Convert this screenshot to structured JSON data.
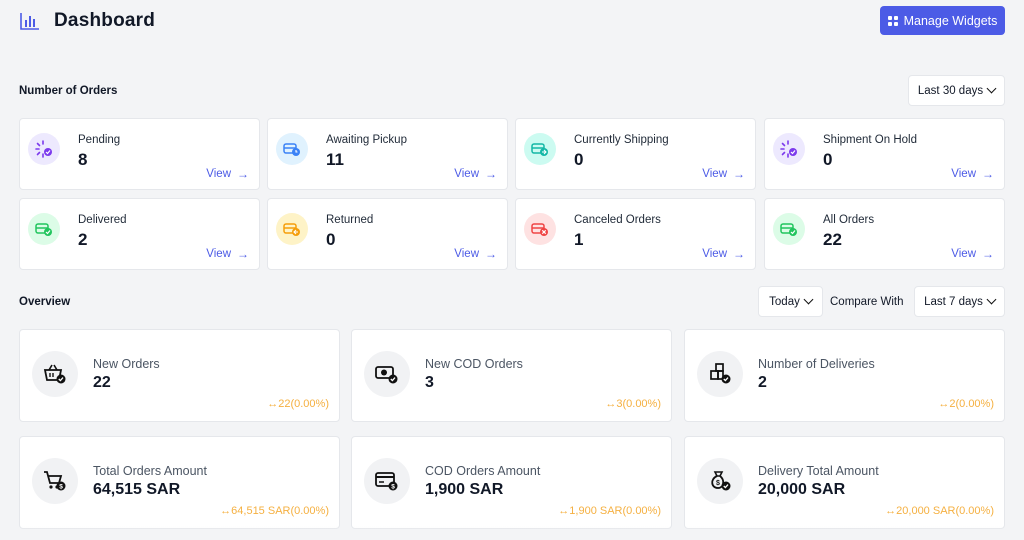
{
  "header": {
    "title": "Dashboard",
    "manage_label": "Manage Widgets",
    "logo_icon": "bar-chart-icon"
  },
  "orders_section": {
    "title": "Number of Orders",
    "range": "Last 30 days",
    "view_label": "View",
    "cards": [
      {
        "label": "Pending",
        "count": "8",
        "icon": "pending-icon",
        "color": "#7c3aed",
        "bg": "#ede9fe"
      },
      {
        "label": "Awaiting Pickup",
        "count": "11",
        "icon": "truck-clock-icon",
        "color": "#3b82f6",
        "bg": "#e0f2fe"
      },
      {
        "label": "Currently Shipping",
        "count": "0",
        "icon": "truck-shipping-icon",
        "color": "#14b8a6",
        "bg": "#ccfbf1"
      },
      {
        "label": "Shipment On Hold",
        "count": "0",
        "icon": "pending-icon",
        "color": "#7c3aed",
        "bg": "#ede9fe"
      },
      {
        "label": "Delivered",
        "count": "2",
        "icon": "truck-check-icon",
        "color": "#22c55e",
        "bg": "#dcfce7"
      },
      {
        "label": "Returned",
        "count": "0",
        "icon": "truck-return-icon",
        "color": "#f59e0b",
        "bg": "#fef3c7"
      },
      {
        "label": "Canceled Orders",
        "count": "1",
        "icon": "truck-cancel-icon",
        "color": "#ef4444",
        "bg": "#fee2e2"
      },
      {
        "label": "All Orders",
        "count": "22",
        "icon": "truck-check-icon",
        "color": "#22c55e",
        "bg": "#dcfce7"
      }
    ]
  },
  "overview": {
    "title": "Overview",
    "period": "Today",
    "compare_label": "Compare With",
    "compare_range": "Last 7 days",
    "cards": [
      {
        "label": "New Orders",
        "value": "22",
        "compare": "↔22(0.00%)",
        "icon": "basket-check-icon"
      },
      {
        "label": "New COD Orders",
        "value": "3",
        "compare": "↔3(0.00%)",
        "icon": "cash-check-icon"
      },
      {
        "label": "Number of Deliveries",
        "value": "2",
        "compare": "↔2(0.00%)",
        "icon": "boxes-check-icon"
      },
      {
        "label": "Total Orders Amount",
        "value": "64,515 SAR",
        "compare": "↔64,515 SAR(0.00%)",
        "icon": "cart-dollar-icon"
      },
      {
        "label": "COD Orders Amount",
        "value": "1,900 SAR",
        "compare": "↔1,900 SAR(0.00%)",
        "icon": "card-dollar-icon"
      },
      {
        "label": "Delivery Total Amount",
        "value": "20,000 SAR",
        "compare": "↔20,000 SAR(0.00%)",
        "icon": "moneybag-check-icon"
      }
    ]
  }
}
